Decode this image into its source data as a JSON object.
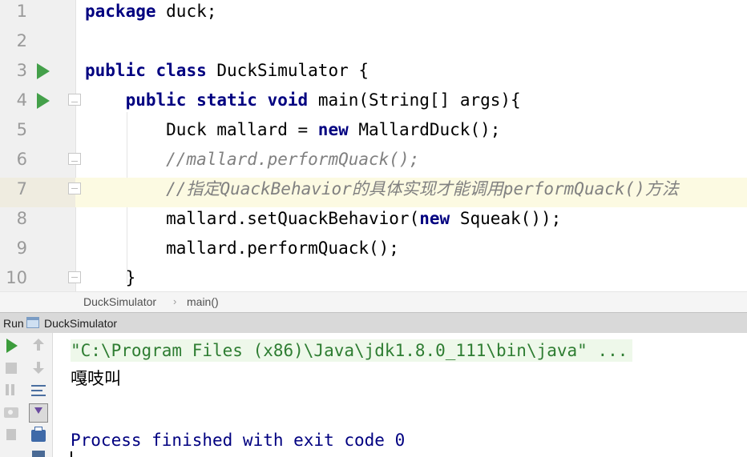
{
  "editor": {
    "lines": [
      {
        "num": "1",
        "tokens": [
          {
            "t": "package",
            "c": "kw"
          },
          {
            "t": " duck;",
            "c": "plain"
          }
        ]
      },
      {
        "num": "2",
        "tokens": []
      },
      {
        "num": "3",
        "tokens": [
          {
            "t": "public",
            "c": "kw"
          },
          {
            "t": " ",
            "c": "plain"
          },
          {
            "t": "class",
            "c": "kw"
          },
          {
            "t": " DuckSimulator {",
            "c": "plain"
          }
        ]
      },
      {
        "num": "4",
        "tokens": [
          {
            "t": "    ",
            "c": "plain"
          },
          {
            "t": "public",
            "c": "kw"
          },
          {
            "t": " ",
            "c": "plain"
          },
          {
            "t": "static",
            "c": "kw"
          },
          {
            "t": " ",
            "c": "plain"
          },
          {
            "t": "void",
            "c": "kw"
          },
          {
            "t": " main(String[] args){",
            "c": "plain"
          }
        ]
      },
      {
        "num": "5",
        "tokens": [
          {
            "t": "        Duck mallard = ",
            "c": "plain"
          },
          {
            "t": "new",
            "c": "kw"
          },
          {
            "t": " MallardDuck();",
            "c": "plain"
          }
        ]
      },
      {
        "num": "6",
        "tokens": [
          {
            "t": "        ",
            "c": "plain"
          },
          {
            "t": "//mallard.performQuack();",
            "c": "comment"
          }
        ]
      },
      {
        "num": "7",
        "tokens": [
          {
            "t": "        ",
            "c": "plain"
          },
          {
            "t": "//指定QuackBehavior的具体实现才能调用performQuack()方法",
            "c": "comment"
          }
        ]
      },
      {
        "num": "8",
        "tokens": [
          {
            "t": "        mallard.setQuackBehavior(",
            "c": "plain"
          },
          {
            "t": "new",
            "c": "kw"
          },
          {
            "t": " Squeak());",
            "c": "plain"
          }
        ]
      },
      {
        "num": "9",
        "tokens": [
          {
            "t": "        mallard.performQuack();",
            "c": "plain"
          }
        ]
      },
      {
        "num": "10",
        "tokens": [
          {
            "t": "    }",
            "c": "plain"
          }
        ]
      }
    ],
    "current_line": "7",
    "run_markers": [
      "3",
      "4"
    ],
    "fold_top": [
      "4",
      "6"
    ],
    "fold_bottom": [
      "7",
      "10"
    ]
  },
  "breadcrumb": {
    "class_name": "DuckSimulator",
    "separator": "›",
    "method_name": "main()"
  },
  "run_panel": {
    "title": "Run",
    "tab_label": "DuckSimulator",
    "console": {
      "command": "\"C:\\Program Files (x86)\\Java\\jdk1.8.0_111\\bin\\java\" ...",
      "output": "嘎吱叫",
      "finish_message": "Process finished with exit code 0"
    }
  },
  "colors": {
    "keyword": "#000080",
    "comment": "#808080",
    "run_green": "#44a04a",
    "current_line": "#fcfae2"
  },
  "icons": [
    "run-icon",
    "stop-icon",
    "pause-icon",
    "camera-icon",
    "exit-icon",
    "scroll-up-icon",
    "scroll-down-icon",
    "soft-wrap-icon",
    "scroll-to-end-icon",
    "print-icon",
    "trash-icon"
  ]
}
